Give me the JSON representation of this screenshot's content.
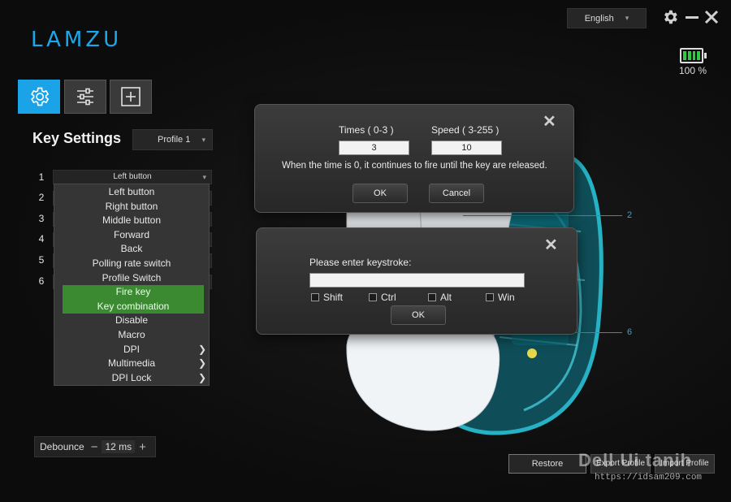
{
  "app": {
    "logo_text": "LAMZU"
  },
  "header": {
    "language": "English",
    "battery_text": "100 %",
    "battery_level": 1.0
  },
  "tabs": [
    {
      "icon": "gear-icon",
      "active": true
    },
    {
      "icon": "sliders-icon",
      "active": false
    },
    {
      "icon": "plus-box-icon",
      "active": false
    }
  ],
  "key_settings": {
    "title": "Key Settings",
    "profile": "Profile 1",
    "rows": [
      {
        "num": "1",
        "value": "Left button"
      },
      {
        "num": "2"
      },
      {
        "num": "3"
      },
      {
        "num": "4"
      },
      {
        "num": "5"
      },
      {
        "num": "6"
      }
    ],
    "dropdown_items": [
      {
        "label": "Left button"
      },
      {
        "label": "Right button"
      },
      {
        "label": "Middle button"
      },
      {
        "label": "Forward"
      },
      {
        "label": "Back"
      },
      {
        "label": "Polling rate switch"
      },
      {
        "label": "Profile Switch"
      },
      {
        "label": "Fire key",
        "highlighted": true
      },
      {
        "label": "Key combination",
        "highlighted": true
      },
      {
        "label": "Disable"
      },
      {
        "label": "Macro"
      },
      {
        "label": "DPI",
        "submenu": true
      },
      {
        "label": "Multimedia",
        "submenu": true
      },
      {
        "label": "DPI Lock",
        "submenu": true
      }
    ]
  },
  "debounce": {
    "label": "Debounce",
    "value": "12 ms"
  },
  "callouts": {
    "two": "2",
    "six": "6"
  },
  "fire_dialog": {
    "times_label": "Times ( 0-3 )",
    "times_value": "3",
    "speed_label": "Speed ( 3-255 )",
    "speed_value": "10",
    "note": "When the time is 0, it continues to fire until the key are released.",
    "ok": "OK",
    "cancel": "Cancel"
  },
  "keystroke_dialog": {
    "prompt": "Please enter keystroke:",
    "input_value": "",
    "modifiers": [
      "Shift",
      "Ctrl",
      "Alt",
      "Win"
    ],
    "ok": "OK"
  },
  "bottom": {
    "restore": "Restore",
    "export": "Export Profile",
    "import": "Import Profile"
  },
  "watermark": {
    "title": "Dell Ui tanih",
    "url": "https://idsam209.com"
  },
  "colors": {
    "accent": "#1aa3e6",
    "highlight": "#3b8a32",
    "battery": "#2ecc40"
  }
}
